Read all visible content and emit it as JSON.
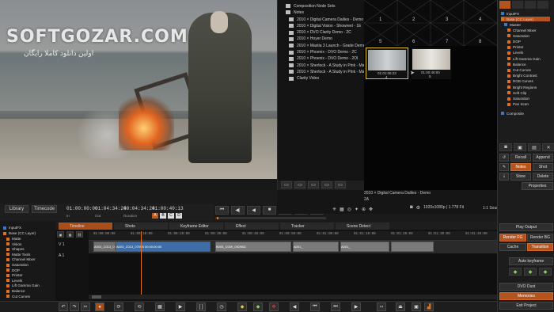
{
  "watermark": {
    "logo": "SOFTGOZAR.COM",
    "tagline": "اولین دانلود کاملا رایگان"
  },
  "timecode_bar": {
    "library": "Library",
    "timecode": "Timecode",
    "in": "01:00:00:00",
    "out": "01:04:34:24",
    "duration": "00:04:34:24",
    "current": "01:00:40:13",
    "in_label": "In",
    "out_label": "Out",
    "duration_label": "Duration",
    "flags": [
      "A",
      "B",
      "C",
      "D"
    ]
  },
  "browser": {
    "header1": "Composition Node Sets",
    "header2": "Notes",
    "items": [
      "2010 × Digital Camera Dailies - Demo 2",
      "2010 × Digital Vision - Showreel - 1E",
      "2010 × DVO Clarity Demo - 2C",
      "2010 × Hoyer Demo",
      "2010 × Mastia 3 Launch - Grade Demo -",
      "2010 × Phoenix - DVO Demo - 2C",
      "2010 × Phoenix - DVO Demo - 2OI",
      "2010 × Sherlock - A Study in Pink - Maste",
      "2010 × Sherlock - A Study in Pink - Maste",
      "Clarity Video"
    ]
  },
  "grid": {
    "numbers": [
      "1",
      "2",
      "3",
      "4",
      "5",
      "6",
      "7",
      "8"
    ]
  },
  "thumbs": [
    {
      "tc": "01:01:05:23",
      "n": "4"
    },
    {
      "tc": "01:00:40:00",
      "n": "5"
    }
  ],
  "clip_info": {
    "title": "2010 × Digital Camera Dailies - Demo",
    "sub": "2A"
  },
  "format": {
    "res": "1920x1080p | 1.778 Fit",
    "source": "1:1 Source Clip"
  },
  "nodes": {
    "input": "InputFX",
    "base": "Base (CC Layer)",
    "master": "Master",
    "items": [
      "Channel Mixer",
      "Saturation",
      "DOP",
      "Printer",
      "Levels",
      "Lift Gamma Gain",
      "Balance",
      "Cut Curves",
      "Bright Contrast",
      "RGB Curves",
      "Bright Regions",
      "Soft Clip",
      "Saturation",
      "Pan Scan"
    ],
    "composite": "Composite"
  },
  "rbuttons": {
    "recall": "Recall",
    "append": "Append",
    "notes": "Notes",
    "shot": "Shot",
    "store": "Store",
    "delete": "Delete",
    "properties": "Properties"
  },
  "tools": {
    "page": "Play Output"
  },
  "tabs": [
    "Timeline",
    "Shots",
    "Keyframe Editor",
    "Effect",
    "Tracker",
    "Scene Detect"
  ],
  "ruler": [
    "01:00:00:00",
    "01:00:10:00",
    "01:00:20:00",
    "01:00:30:00",
    "01:00:40:00",
    "01:00:50:00",
    "01:01:00:00",
    "01:01:10:00",
    "01:01:20:00",
    "01:01:30:00",
    "01:01:40:00",
    "01:01:50:00"
  ],
  "track": {
    "v1": "V 1",
    "a1": "A 1"
  },
  "clips": [
    {
      "label": "A003_C013_0709B",
      "color": "#6f6f6f"
    },
    {
      "label": "A003_C013_0709B 00:00:00:00",
      "color": "#3e6ea8"
    },
    {
      "label": "B005_C009_0929BD",
      "color": "#777"
    },
    {
      "label": "A001_",
      "color": "#777"
    },
    {
      "label": "A001_",
      "color": "#777"
    },
    {
      "label": "",
      "color": "#777"
    }
  ],
  "layers": {
    "input": "InputFX",
    "base": "Base (CC Layer)",
    "items": [
      "Matte",
      "Vision",
      "Shapes",
      "Matte Tools",
      "Channel Mixer",
      "Saturation",
      "DOP",
      "Printer",
      "Levels",
      "Lift Gamma Gain",
      "Balance",
      "Cut Curves"
    ]
  },
  "side_buttons": {
    "play_output": "Play Output",
    "render_fg": "Render FG",
    "render_bg": "Render BG",
    "cache": "Cache",
    "transition": "Transition",
    "auto_keyframe": "Auto keyframe",
    "dvo_dust": "DVO Dust",
    "memories": "Memories",
    "exit": "Exit Project"
  },
  "colors": {
    "accent": "#e07020",
    "clip_blue": "#3e6ea8"
  }
}
